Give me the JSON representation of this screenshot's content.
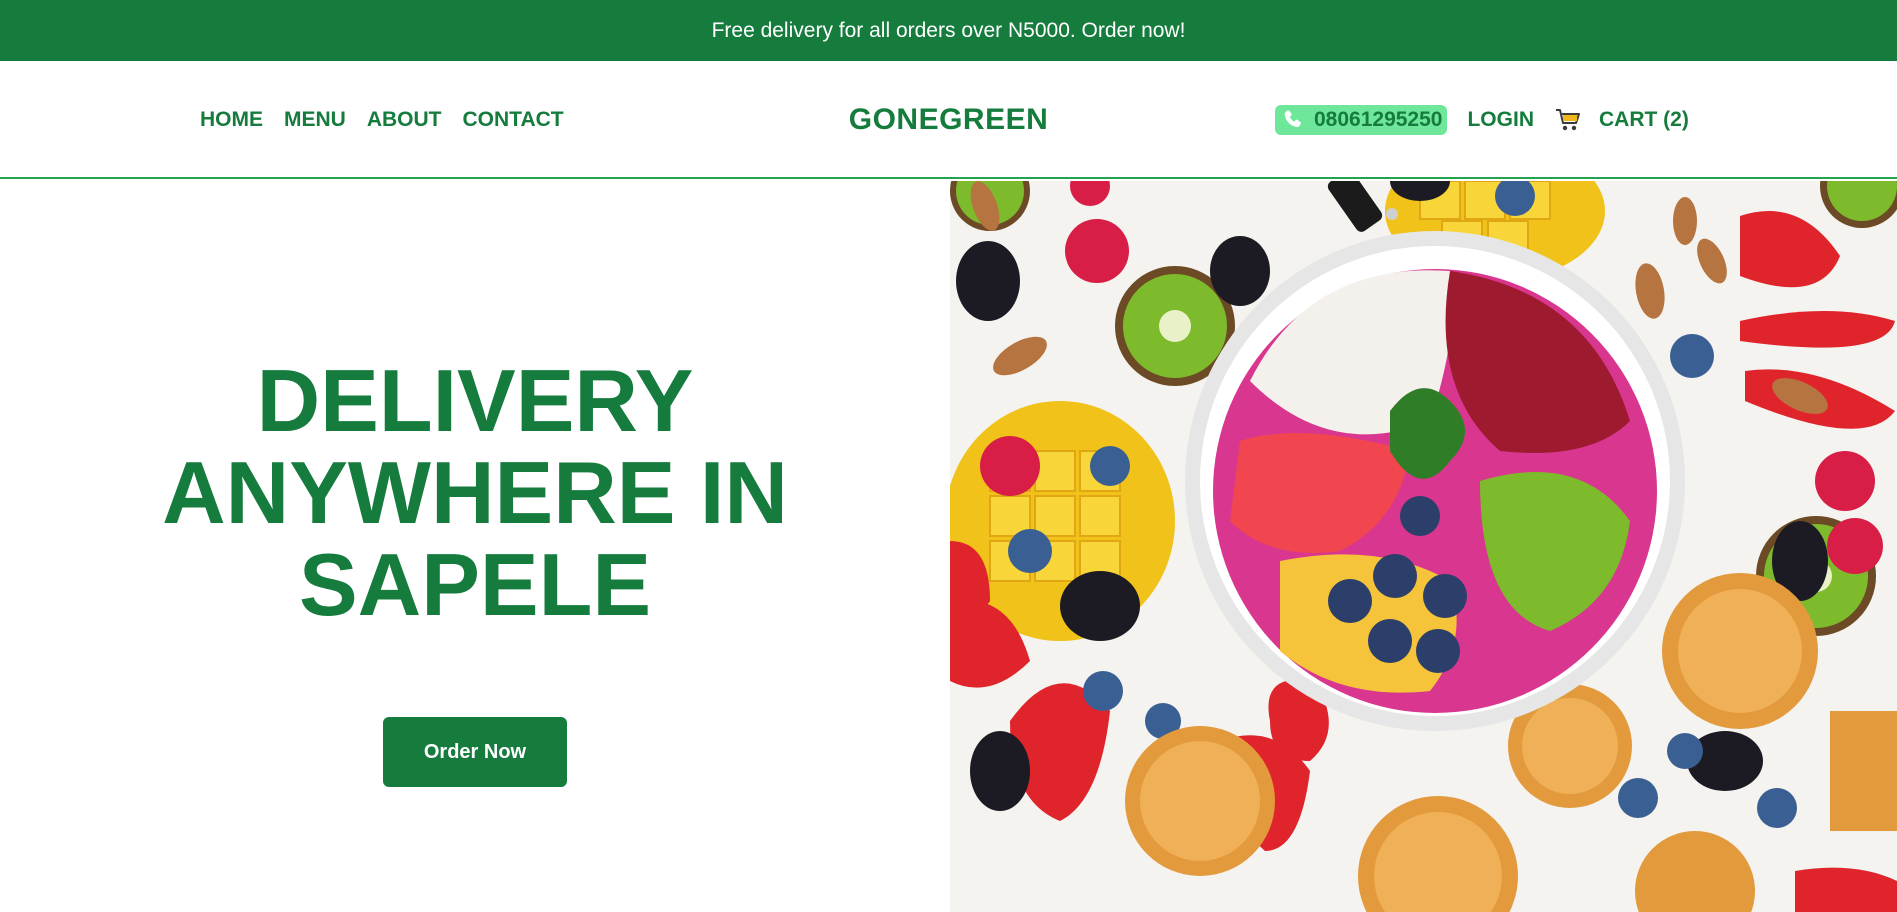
{
  "announcement": "Free delivery for all orders over N5000. Order now!",
  "nav": {
    "links": [
      "HOME",
      "MENU",
      "ABOUT",
      "CONTACT"
    ],
    "brand": "GONEGREEN",
    "phone": "08061295250",
    "login": "LOGIN",
    "cart": "CART (2)"
  },
  "hero": {
    "headline_lines": [
      "DELIVERY",
      "ANYWHERE IN",
      "SAPELE"
    ],
    "cta": "Order Now",
    "image_description_icon": "fruit-bowl-photo"
  },
  "colors": {
    "brand_green": "#157c3d",
    "accent_green": "#22a34f",
    "phone_pill": "#6ee79a"
  }
}
